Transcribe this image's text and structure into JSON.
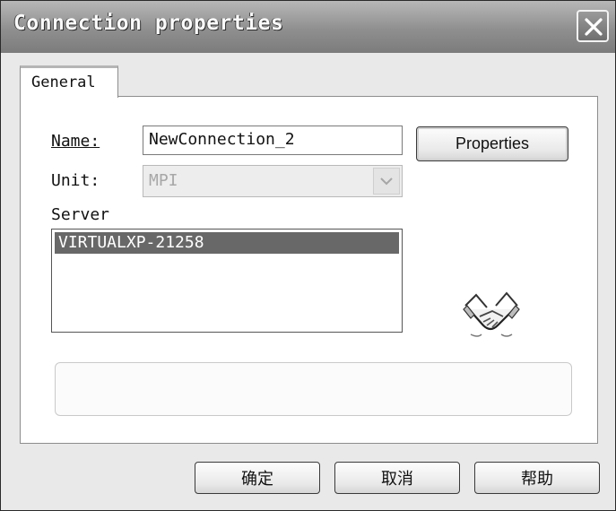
{
  "window": {
    "title": "Connection properties",
    "close_icon": "close-icon"
  },
  "tabs": [
    {
      "label": "General",
      "selected": true
    }
  ],
  "form": {
    "name_label": "Name:",
    "name_value": "NewConnection_2",
    "unit_label": "Unit:",
    "unit_value": "MPI",
    "server_label": "Server",
    "servers": [
      "VIRTUALXP-21258"
    ],
    "selected_server": "VIRTUALXP-21258"
  },
  "buttons": {
    "properties": "Properties",
    "ok": "确定",
    "cancel": "取消",
    "help": "帮助"
  },
  "icons": {
    "connection": "handshake-icon",
    "dropdown": "chevron-down-icon"
  }
}
